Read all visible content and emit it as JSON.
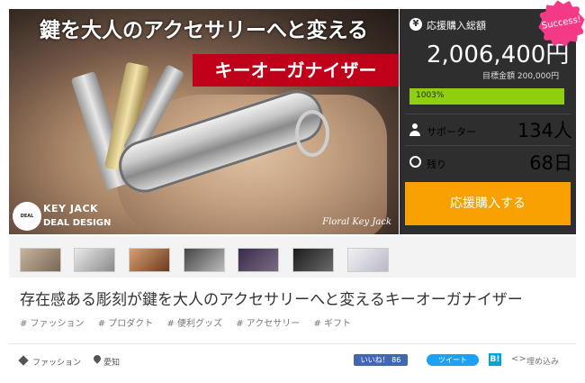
{
  "hero": {
    "title": "鍵を大人のアクセサリーへと変える",
    "ribbon": "キーオーガナイザー",
    "logo_text": "DEAL DESIGN",
    "logo_key": "KEY JACK",
    "logo_deal": "DEAL DESIGN",
    "caption": "Floral Key Jack"
  },
  "badge": {
    "label": "Success!"
  },
  "panel": {
    "total_label": "応援購入総額",
    "amount": "2,006,400円",
    "goal": "目標金額 200,000円",
    "progress_text": "1003%",
    "progress_percent": 100,
    "supporters_label": "サポーター",
    "supporters_count": "134人",
    "remaining_label": "残り",
    "remaining_count": "68日",
    "buy_button": "応援購入する"
  },
  "main": {
    "title": "存在感ある彫刻が鍵を大人のアクセサリーへと変えるキーオーガナイザー"
  },
  "tags": [
    "# ファッション",
    "# プロダクト",
    "# 便利グッズ",
    "# アクセサリー",
    "# ギフト"
  ],
  "footer": {
    "category": "ファッション",
    "location": "愛知",
    "like_button": "いいね！ 86",
    "tweet_button": "ツイート",
    "hatena_button": "B!",
    "embed_label": "埋め込み"
  },
  "colors": {
    "panel_bg": "#2e2e2e",
    "progress": "#8ecf11",
    "buy_button": "#f8a000",
    "success_badge": "#f43a87",
    "ribbon": "#c0001b"
  }
}
